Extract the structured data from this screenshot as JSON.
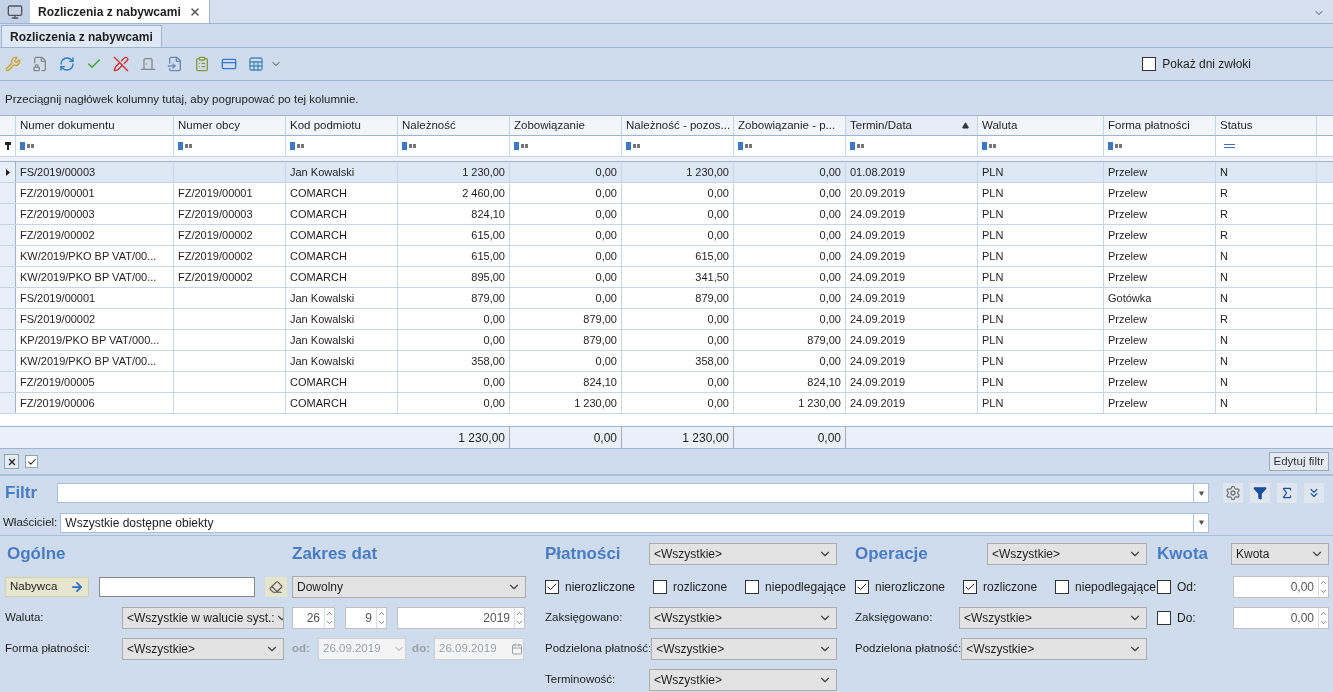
{
  "tab_bar": {
    "tabs": [
      {
        "label": "Rozliczenia z nabywcami",
        "selected": true
      }
    ]
  },
  "subtab": {
    "label": "Rozliczenia z nabywcami",
    "selected": true
  },
  "toolbar": {
    "show_delay": {
      "label": "Pokaż dni zwłoki",
      "checked": false
    }
  },
  "group_hint": "Przeciągnij nagłówek kolumny tutaj, aby pogrupować po tej kolumnie.",
  "table": {
    "columns": [
      {
        "label": "Numer dokumentu",
        "kind": "text",
        "sorted": false
      },
      {
        "label": "Numer obcy",
        "kind": "text",
        "sorted": false
      },
      {
        "label": "Kod podmiotu",
        "kind": "text",
        "sorted": false
      },
      {
        "label": "Należność",
        "kind": "amount",
        "sorted": false
      },
      {
        "label": "Zobowiązanie",
        "kind": "amount",
        "sorted": false
      },
      {
        "label": "Należność - pozos...",
        "kind": "amount",
        "sorted": false
      },
      {
        "label": "Zobowiązanie - p...",
        "kind": "amount",
        "sorted": false
      },
      {
        "label": "Termin/Data",
        "kind": "text",
        "sorted": true
      },
      {
        "label": "Waluta",
        "kind": "text",
        "sorted": false
      },
      {
        "label": "Forma płatności",
        "kind": "text",
        "sorted": false
      },
      {
        "label": "Status",
        "kind": "status",
        "sorted": false
      }
    ],
    "rows": [
      {
        "selected": true,
        "cells": [
          "FS/2019/00003",
          "",
          "Jan Kowalski",
          "1 230,00",
          "0,00",
          "1 230,00",
          "0,00",
          "01.08.2019",
          "PLN",
          "Przelew",
          "N"
        ]
      },
      {
        "selected": false,
        "cells": [
          "FZ/2019/00001",
          "FZ/2019/00001",
          "COMARCH",
          "2 460,00",
          "0,00",
          "0,00",
          "0,00",
          "20.09.2019",
          "PLN",
          "Przelew",
          "R"
        ]
      },
      {
        "selected": false,
        "cells": [
          "FZ/2019/00003",
          "FZ/2019/00003",
          "COMARCH",
          "824,10",
          "0,00",
          "0,00",
          "0,00",
          "24.09.2019",
          "PLN",
          "Przelew",
          "R"
        ]
      },
      {
        "selected": false,
        "cells": [
          "FZ/2019/00002",
          "FZ/2019/00002",
          "COMARCH",
          "615,00",
          "0,00",
          "0,00",
          "0,00",
          "24.09.2019",
          "PLN",
          "Przelew",
          "R"
        ]
      },
      {
        "selected": false,
        "cells": [
          "KW/2019/PKO BP VAT/00...",
          "FZ/2019/00002",
          "COMARCH",
          "615,00",
          "0,00",
          "615,00",
          "0,00",
          "24.09.2019",
          "PLN",
          "Przelew",
          "N"
        ]
      },
      {
        "selected": false,
        "cells": [
          "KW/2019/PKO BP VAT/00...",
          "FZ/2019/00002",
          "COMARCH",
          "895,00",
          "0,00",
          "341,50",
          "0,00",
          "24.09.2019",
          "PLN",
          "Przelew",
          "N"
        ]
      },
      {
        "selected": false,
        "cells": [
          "FS/2019/00001",
          "",
          "Jan Kowalski",
          "879,00",
          "0,00",
          "879,00",
          "0,00",
          "24.09.2019",
          "PLN",
          "Gotówka",
          "N"
        ]
      },
      {
        "selected": false,
        "cells": [
          "FS/2019/00002",
          "",
          "Jan Kowalski",
          "0,00",
          "879,00",
          "0,00",
          "0,00",
          "24.09.2019",
          "PLN",
          "Przelew",
          "R"
        ]
      },
      {
        "selected": false,
        "cells": [
          "KP/2019/PKO BP VAT/000...",
          "",
          "Jan Kowalski",
          "0,00",
          "879,00",
          "0,00",
          "879,00",
          "24.09.2019",
          "PLN",
          "Przelew",
          "N"
        ]
      },
      {
        "selected": false,
        "cells": [
          "KW/2019/PKO BP VAT/00...",
          "",
          "Jan Kowalski",
          "358,00",
          "0,00",
          "358,00",
          "0,00",
          "24.09.2019",
          "PLN",
          "Przelew",
          "N"
        ]
      },
      {
        "selected": false,
        "cells": [
          "FZ/2019/00005",
          "",
          "COMARCH",
          "0,00",
          "824,10",
          "0,00",
          "824,10",
          "24.09.2019",
          "PLN",
          "Przelew",
          "N"
        ]
      },
      {
        "selected": false,
        "cells": [
          "FZ/2019/00006",
          "",
          "COMARCH",
          "0,00",
          "1 230,00",
          "0,00",
          "1 230,00",
          "24.09.2019",
          "PLN",
          "Przelew",
          "N"
        ]
      }
    ],
    "totals": [
      "1 230,00",
      "0,00",
      "1 230,00",
      "0,00"
    ]
  },
  "filter_bar": {
    "filter_enabled": true,
    "edit_button": "Edytuj filtr"
  },
  "filter": {
    "label": "Filtr",
    "owner_label": "Właściciel:",
    "owner_value": "Wszystkie dostępne obiekty"
  },
  "general": {
    "title": "Ogólne",
    "buyer_button": "Nabywca",
    "currency_label": "Waluta:",
    "currency": "<Wszystkie w walucie syst.:",
    "payment_form_label": "Forma płatności:",
    "payment_form": "<Wszystkie>"
  },
  "date_range": {
    "title": "Zakres dat",
    "mode": "Dowolny",
    "day": "26",
    "month": "9",
    "year": "2019",
    "from_label": "od:",
    "from": "26.09.2019",
    "to_label": "do:",
    "to": "26.09.2019"
  },
  "payments": {
    "title": "Płatności",
    "select": "<Wszystkie>",
    "checks": [
      {
        "label": "nierozliczone",
        "checked": true
      },
      {
        "label": "rozliczone",
        "checked": false
      },
      {
        "label": "niepodlegające",
        "checked": false
      }
    ],
    "fields": [
      {
        "label": "Zaksięgowano:",
        "value": "<Wszystkie>"
      },
      {
        "label": "Podzielona płatność:",
        "value": "<Wszystkie>"
      },
      {
        "label": "Terminowość:",
        "value": "<Wszystkie>"
      }
    ]
  },
  "operations": {
    "title": "Operacje",
    "select": "<Wszystkie>",
    "checks": [
      {
        "label": "nierozliczone",
        "checked": true
      },
      {
        "label": "rozliczone",
        "checked": true
      },
      {
        "label": "niepodlegające",
        "checked": false
      }
    ],
    "fields": [
      {
        "label": "Zaksięgowano:",
        "value": "<Wszystkie>"
      },
      {
        "label": "Podzielona płatność:",
        "value": "<Wszystkie>"
      }
    ]
  },
  "amount": {
    "title": "Kwota",
    "select": "Kwota",
    "from": {
      "label": "Od:",
      "checked": false,
      "value": "0,00"
    },
    "to": {
      "label": "Do:",
      "checked": false,
      "value": "0,00"
    }
  }
}
